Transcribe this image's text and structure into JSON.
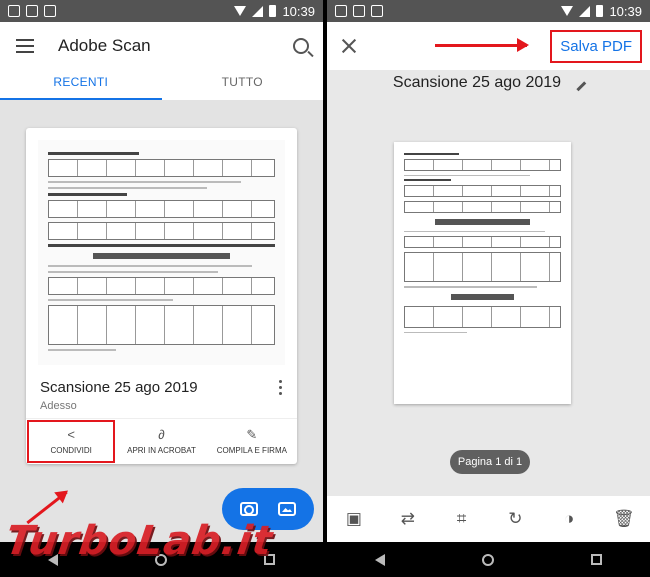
{
  "status_bar": {
    "time": "10:39"
  },
  "left": {
    "app_title": "Adobe Scan",
    "tabs": [
      {
        "label": "RECENTI",
        "active": true
      },
      {
        "label": "TUTTO",
        "active": false
      }
    ],
    "card": {
      "name": "Scansione 25 ago 2019",
      "subtitle": "Adesso",
      "actions": [
        {
          "label": "CONDIVIDI",
          "icon": "share-icon",
          "highlighted": true
        },
        {
          "label": "APRI IN ACROBAT",
          "icon": "acrobat-icon",
          "highlighted": false
        },
        {
          "label": "COMPILA E FIRMA",
          "icon": "sign-pen-icon",
          "highlighted": false
        }
      ]
    },
    "fab": {
      "icons": [
        "camera-icon",
        "gallery-icon"
      ]
    }
  },
  "right": {
    "save_label": "Salva PDF",
    "doc_title": "Scansione 25 ago 2019",
    "page_indicator": "Pagina 1 di 1",
    "toolbar_icons": [
      "add-page-icon",
      "reorder-icon",
      "crop-icon",
      "rotate-icon",
      "color-filter-icon",
      "delete-icon"
    ]
  },
  "watermark": "TurboLab.it",
  "colors": {
    "accent": "#1473e6",
    "annotation_red": "#e3171d",
    "status_bar": "#545454"
  }
}
